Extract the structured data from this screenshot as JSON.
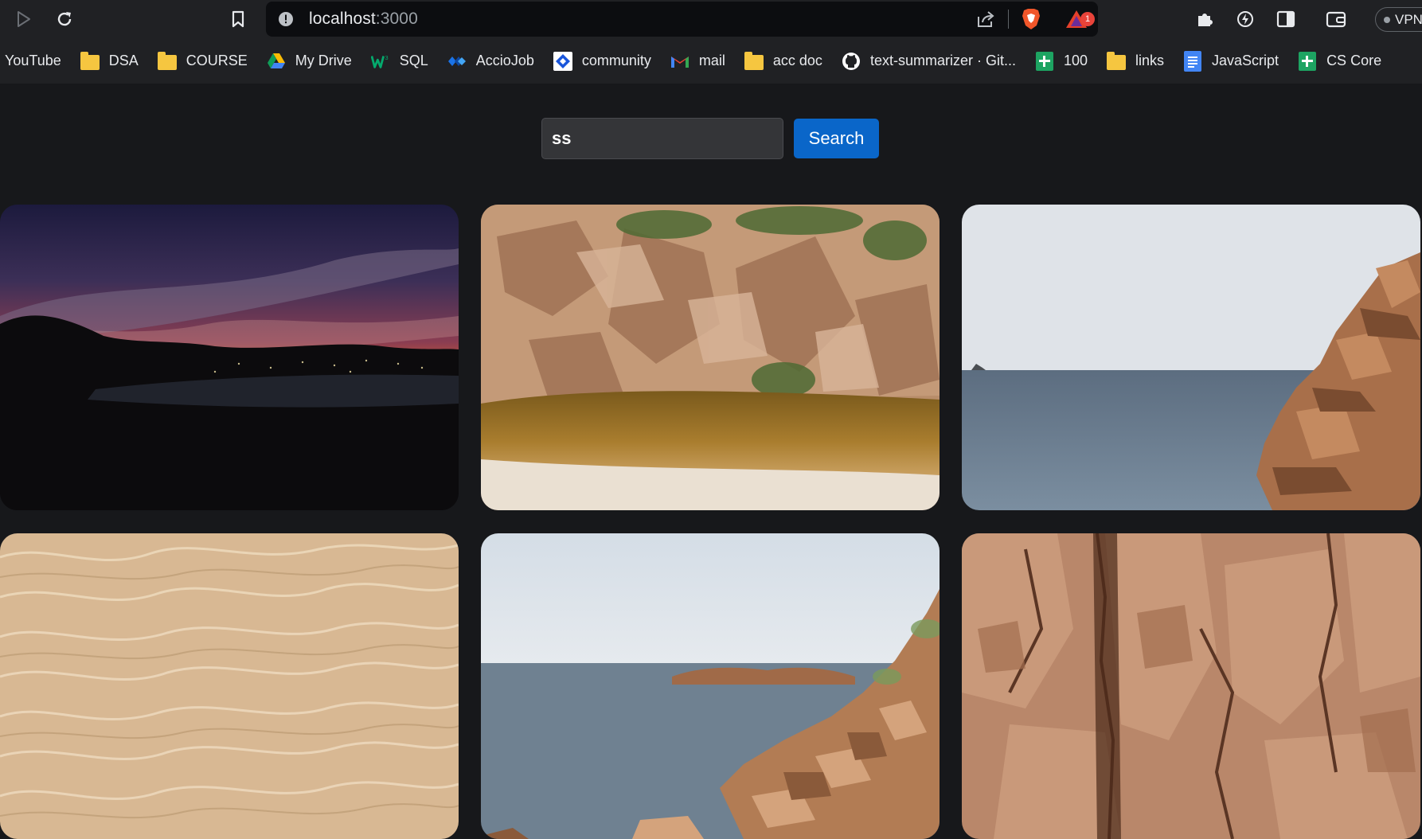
{
  "browser": {
    "url_host": "localhost",
    "url_port": ":3000",
    "brave_badge_count": "1",
    "vpn_label": "VPN"
  },
  "bookmarks": [
    {
      "label": "YouTube",
      "icon": "youtube-icon"
    },
    {
      "label": "DSA",
      "icon": "folder-icon"
    },
    {
      "label": "COURSE",
      "icon": "folder-icon"
    },
    {
      "label": "My Drive",
      "icon": "google-drive-icon"
    },
    {
      "label": "SQL",
      "icon": "w3schools-icon"
    },
    {
      "label": "AccioJob",
      "icon": "acciojob-icon"
    },
    {
      "label": "community",
      "icon": "community-icon"
    },
    {
      "label": "mail",
      "icon": "gmail-icon"
    },
    {
      "label": "acc doc",
      "icon": "folder-icon"
    },
    {
      "label": "text-summarizer · Git...",
      "icon": "github-icon"
    },
    {
      "label": "100",
      "icon": "google-sheets-icon"
    },
    {
      "label": "links",
      "icon": "folder-icon"
    },
    {
      "label": "JavaScript",
      "icon": "google-docs-icon"
    },
    {
      "label": "CS Core",
      "icon": "google-sheets-icon"
    }
  ],
  "search": {
    "value": "ss",
    "button_label": "Search"
  },
  "gallery": {
    "images": [
      {
        "subject": "sunset-over-bay"
      },
      {
        "subject": "rocky-cliff-lagoon"
      },
      {
        "subject": "sea-and-rock"
      },
      {
        "subject": "clear-water-sand"
      },
      {
        "subject": "rocky-coastline"
      },
      {
        "subject": "rock-face-closeup"
      }
    ]
  }
}
